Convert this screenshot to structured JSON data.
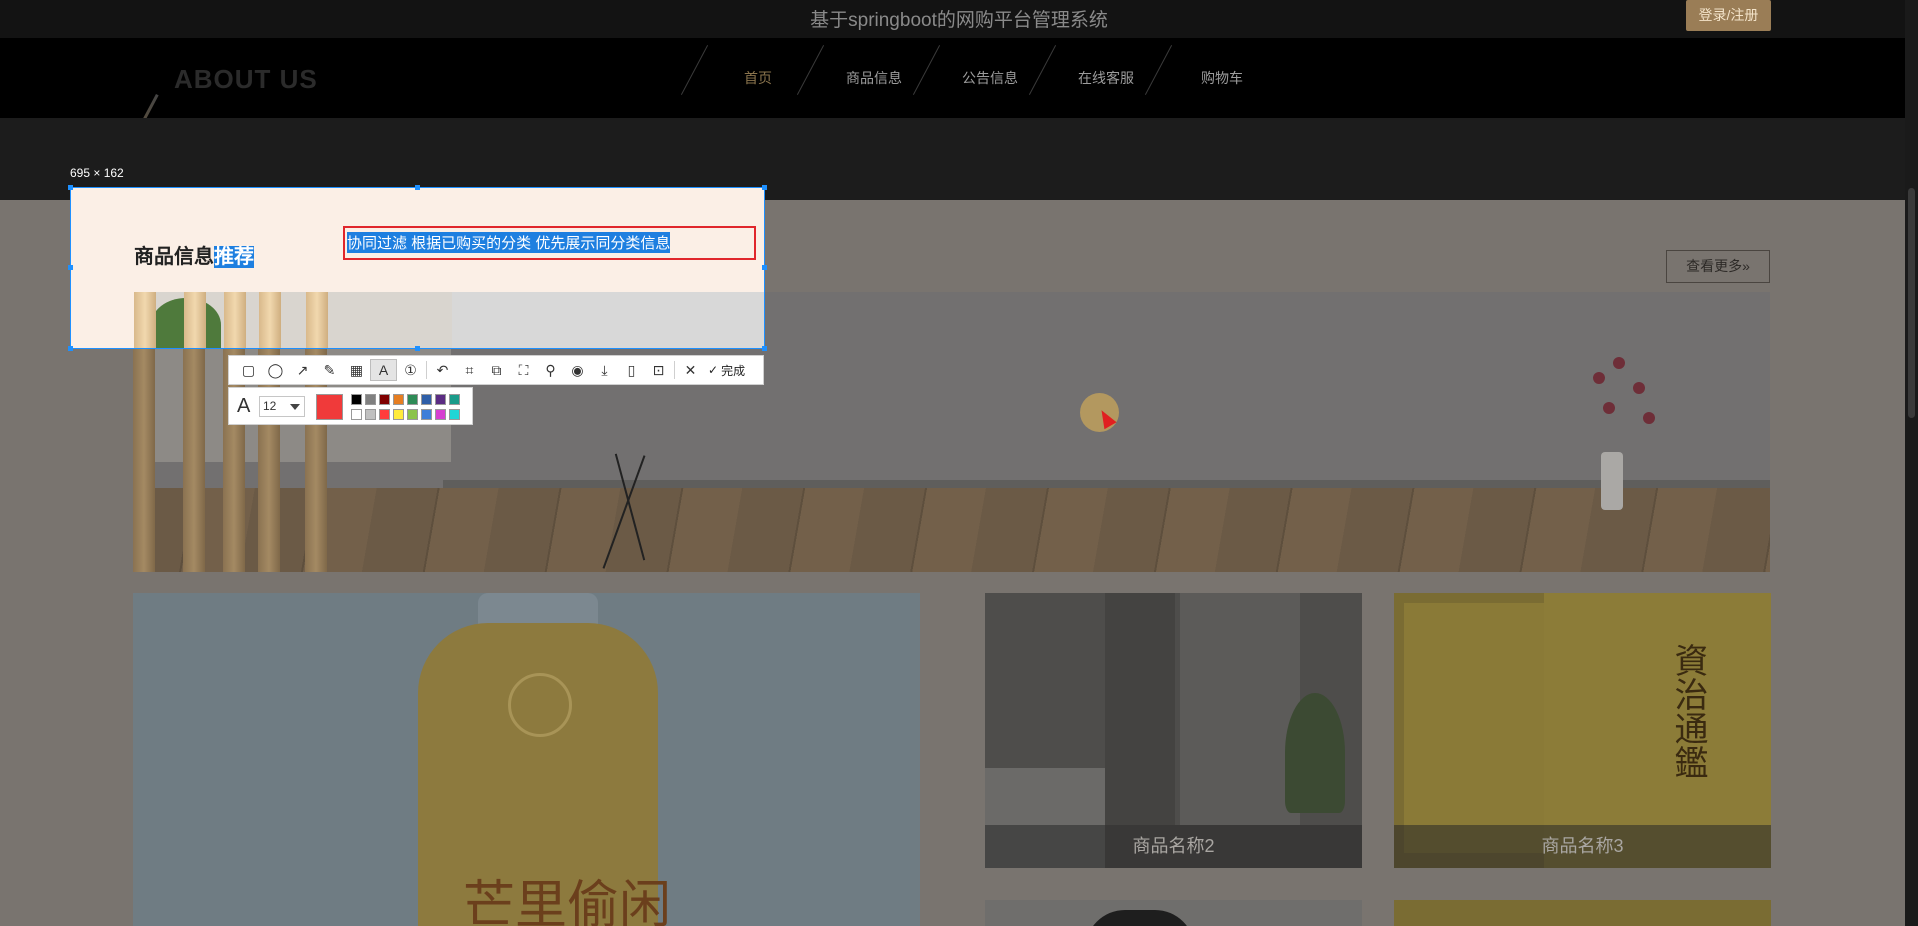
{
  "header": {
    "site_title": "基于springboot的网购平台管理系统",
    "login_label": "登录/注册",
    "ghost_heading": "ABOUT US"
  },
  "nav": {
    "items": [
      {
        "label": "首页",
        "active": true
      },
      {
        "label": "商品信息",
        "active": false
      },
      {
        "label": "公告信息",
        "active": false
      },
      {
        "label": "在线客服",
        "active": false
      },
      {
        "label": "购物车",
        "active": false
      }
    ]
  },
  "section": {
    "heading_main": "商品信息",
    "heading_highlight": "推荐",
    "more_label": "查看更多",
    "more_icon": "double-chevron-right-icon"
  },
  "products": [
    {
      "name": "商品名称2"
    },
    {
      "name": "商品名称3"
    }
  ],
  "product_images": {
    "bottle_label": "芒里偷闲",
    "book_title": "資治通鑑"
  },
  "screenshot_tool": {
    "size_label": "695 × 162",
    "annotation_text": "协同过滤 根据已购买的分类  优先展示同分类信息",
    "tools": [
      "rectangle-icon",
      "ellipse-icon",
      "arrow-icon",
      "pencil-icon",
      "mosaic-icon",
      "text-icon",
      "number-icon",
      "undo-icon",
      "crop-icon",
      "copy-icon",
      "scan-icon",
      "pin-icon",
      "record-icon",
      "download-icon",
      "phone-icon",
      "bookmark-icon",
      "close-icon"
    ],
    "done_label": "完成",
    "font_size": "12",
    "current_color": "#f03a3a",
    "palette": [
      "#000000",
      "#808080",
      "#800000",
      "#e67e22",
      "#2e8b57",
      "#2f5fa8",
      "#5b2c83",
      "#1a9b8a",
      "#ffffff",
      "#c0c0c0",
      "#ff3b3b",
      "#ffeb3b",
      "#8bc34a",
      "#3f7fd9",
      "#d63fd0",
      "#1fd6d6"
    ]
  }
}
